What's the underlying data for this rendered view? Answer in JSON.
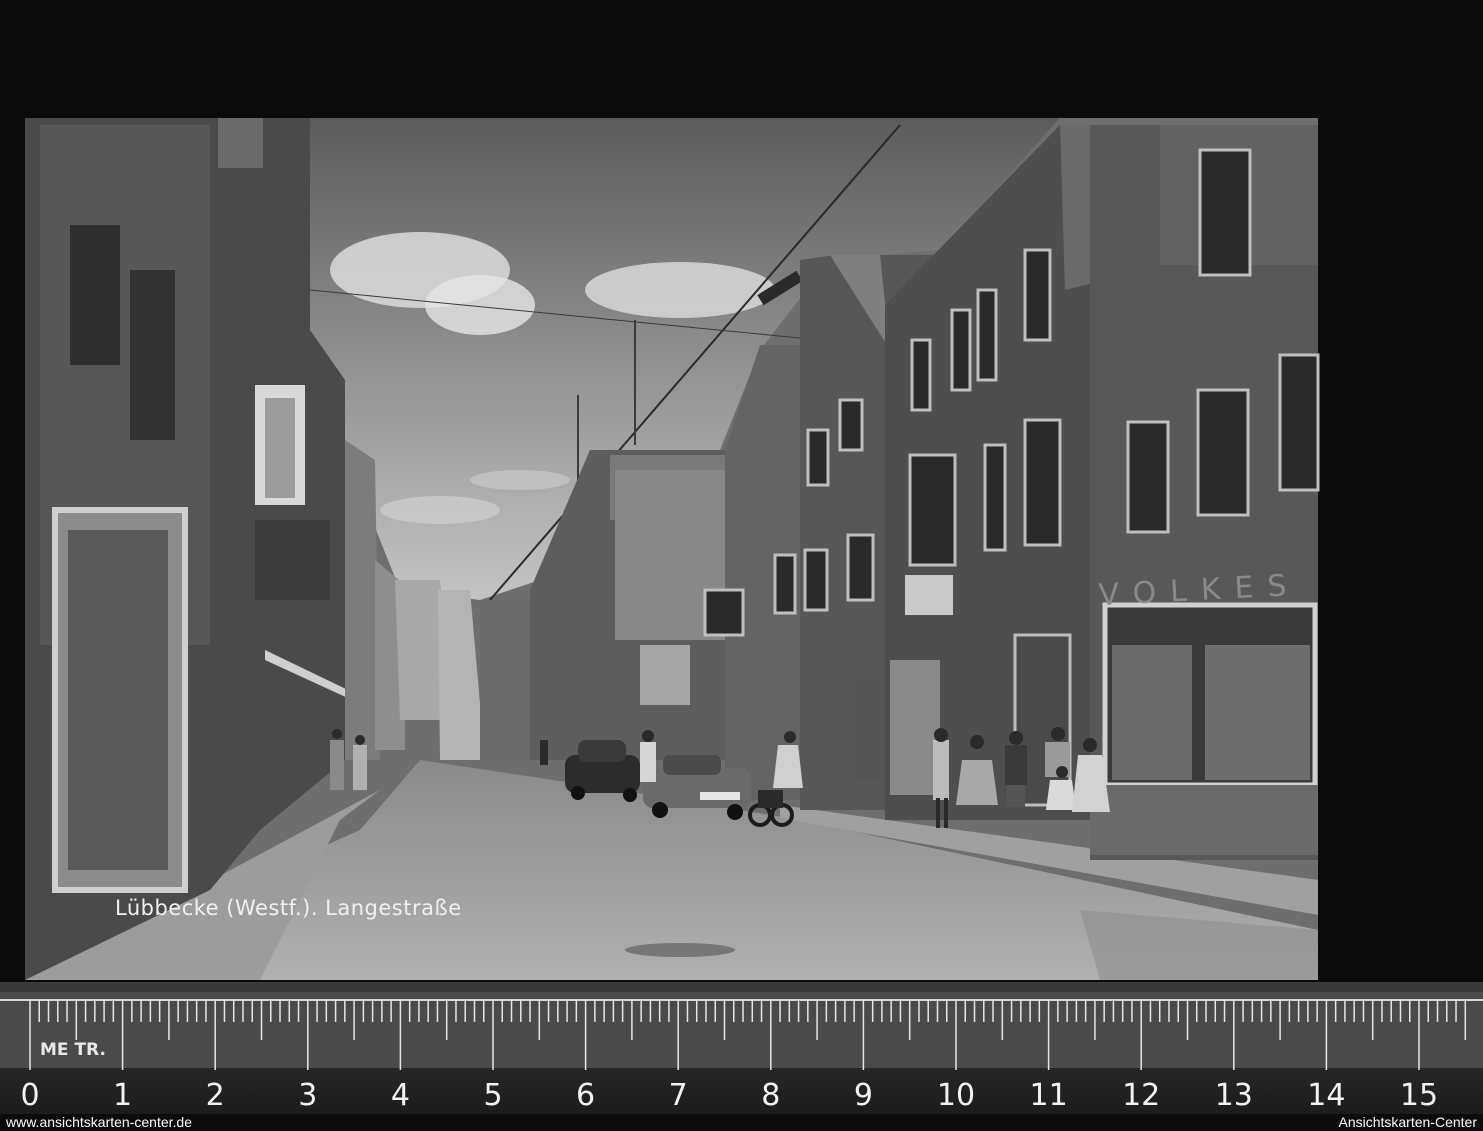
{
  "photo": {
    "caption": "Lübbecke (Westf.). Langestraße",
    "shop_sign": "VOLKES"
  },
  "ruler": {
    "label": "ME TR.",
    "numbers": [
      "0",
      "1",
      "2",
      "3",
      "4",
      "5",
      "6",
      "7",
      "8",
      "9",
      "10",
      "11",
      "12",
      "13",
      "14",
      "15"
    ]
  },
  "watermarks": {
    "left": "www.ansichtskarten-center.de",
    "right": "Ansichtskarten-Center"
  }
}
